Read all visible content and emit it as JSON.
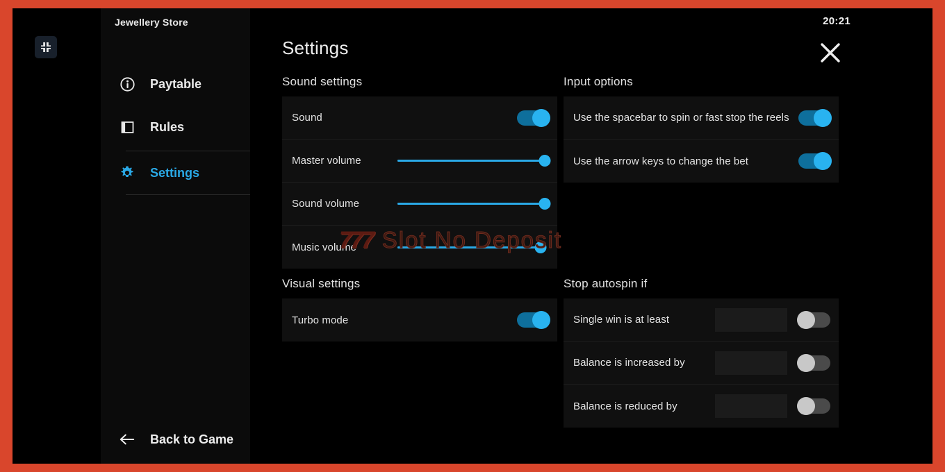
{
  "window": {
    "frame_color": "#d9462c",
    "background": "#000000",
    "clock": "20:21"
  },
  "toolbar": {
    "fullscreen_icon": "exit-fullscreen-icon",
    "close_icon": "close-icon"
  },
  "sidebar": {
    "game_title": "Jewellery Store",
    "items": [
      {
        "label": "Paytable",
        "icon": "info-icon",
        "active": false
      },
      {
        "label": "Rules",
        "icon": "book-icon",
        "active": false
      },
      {
        "label": "Settings",
        "icon": "gear-icon",
        "active": true
      }
    ],
    "back": {
      "label": "Back to Game",
      "icon": "arrow-left-icon"
    }
  },
  "main": {
    "title": "Settings",
    "sections": [
      {
        "id": "sound-settings",
        "heading": "Sound settings",
        "rows": [
          {
            "label": "Sound",
            "control": "toggle",
            "state": "on"
          },
          {
            "label": "Master volume",
            "control": "slider",
            "value": 100
          },
          {
            "label": "Sound volume",
            "control": "slider",
            "value": 100
          },
          {
            "label": "Music volume",
            "control": "slider",
            "value": 97
          }
        ]
      },
      {
        "id": "input-options",
        "heading": "Input options",
        "rows": [
          {
            "label": "Use the spacebar to spin or fast stop the reels",
            "control": "toggle",
            "state": "on"
          },
          {
            "label": "Use the arrow keys to change the bet",
            "control": "toggle",
            "state": "on"
          }
        ]
      },
      {
        "id": "visual-settings",
        "heading": "Visual settings",
        "rows": [
          {
            "label": "Turbo mode",
            "control": "toggle",
            "state": "on"
          }
        ]
      },
      {
        "id": "stop-autospin-if",
        "heading": "Stop autospin if",
        "rows": [
          {
            "label": "Single win is at least",
            "control": "field-toggle",
            "state": "off",
            "value": "",
            "placeholder": ""
          },
          {
            "label": "Balance is increased by",
            "control": "field-toggle",
            "state": "off",
            "value": "",
            "placeholder": ""
          },
          {
            "label": "Balance is reduced by",
            "control": "field-toggle",
            "state": "off",
            "value": "",
            "placeholder": ""
          }
        ]
      }
    ]
  },
  "watermark": {
    "logo": "777",
    "text": "Slot No Deposit"
  },
  "colors": {
    "accent_blue": "#2aa9e6",
    "toggle_on_track": "#0e6f9c",
    "toggle_on_knob": "#29b3f0",
    "toggle_off_track": "#4a4a4a",
    "toggle_off_knob": "#c8c8c8",
    "frame_orange": "#d9462c",
    "panel": "#101010"
  }
}
